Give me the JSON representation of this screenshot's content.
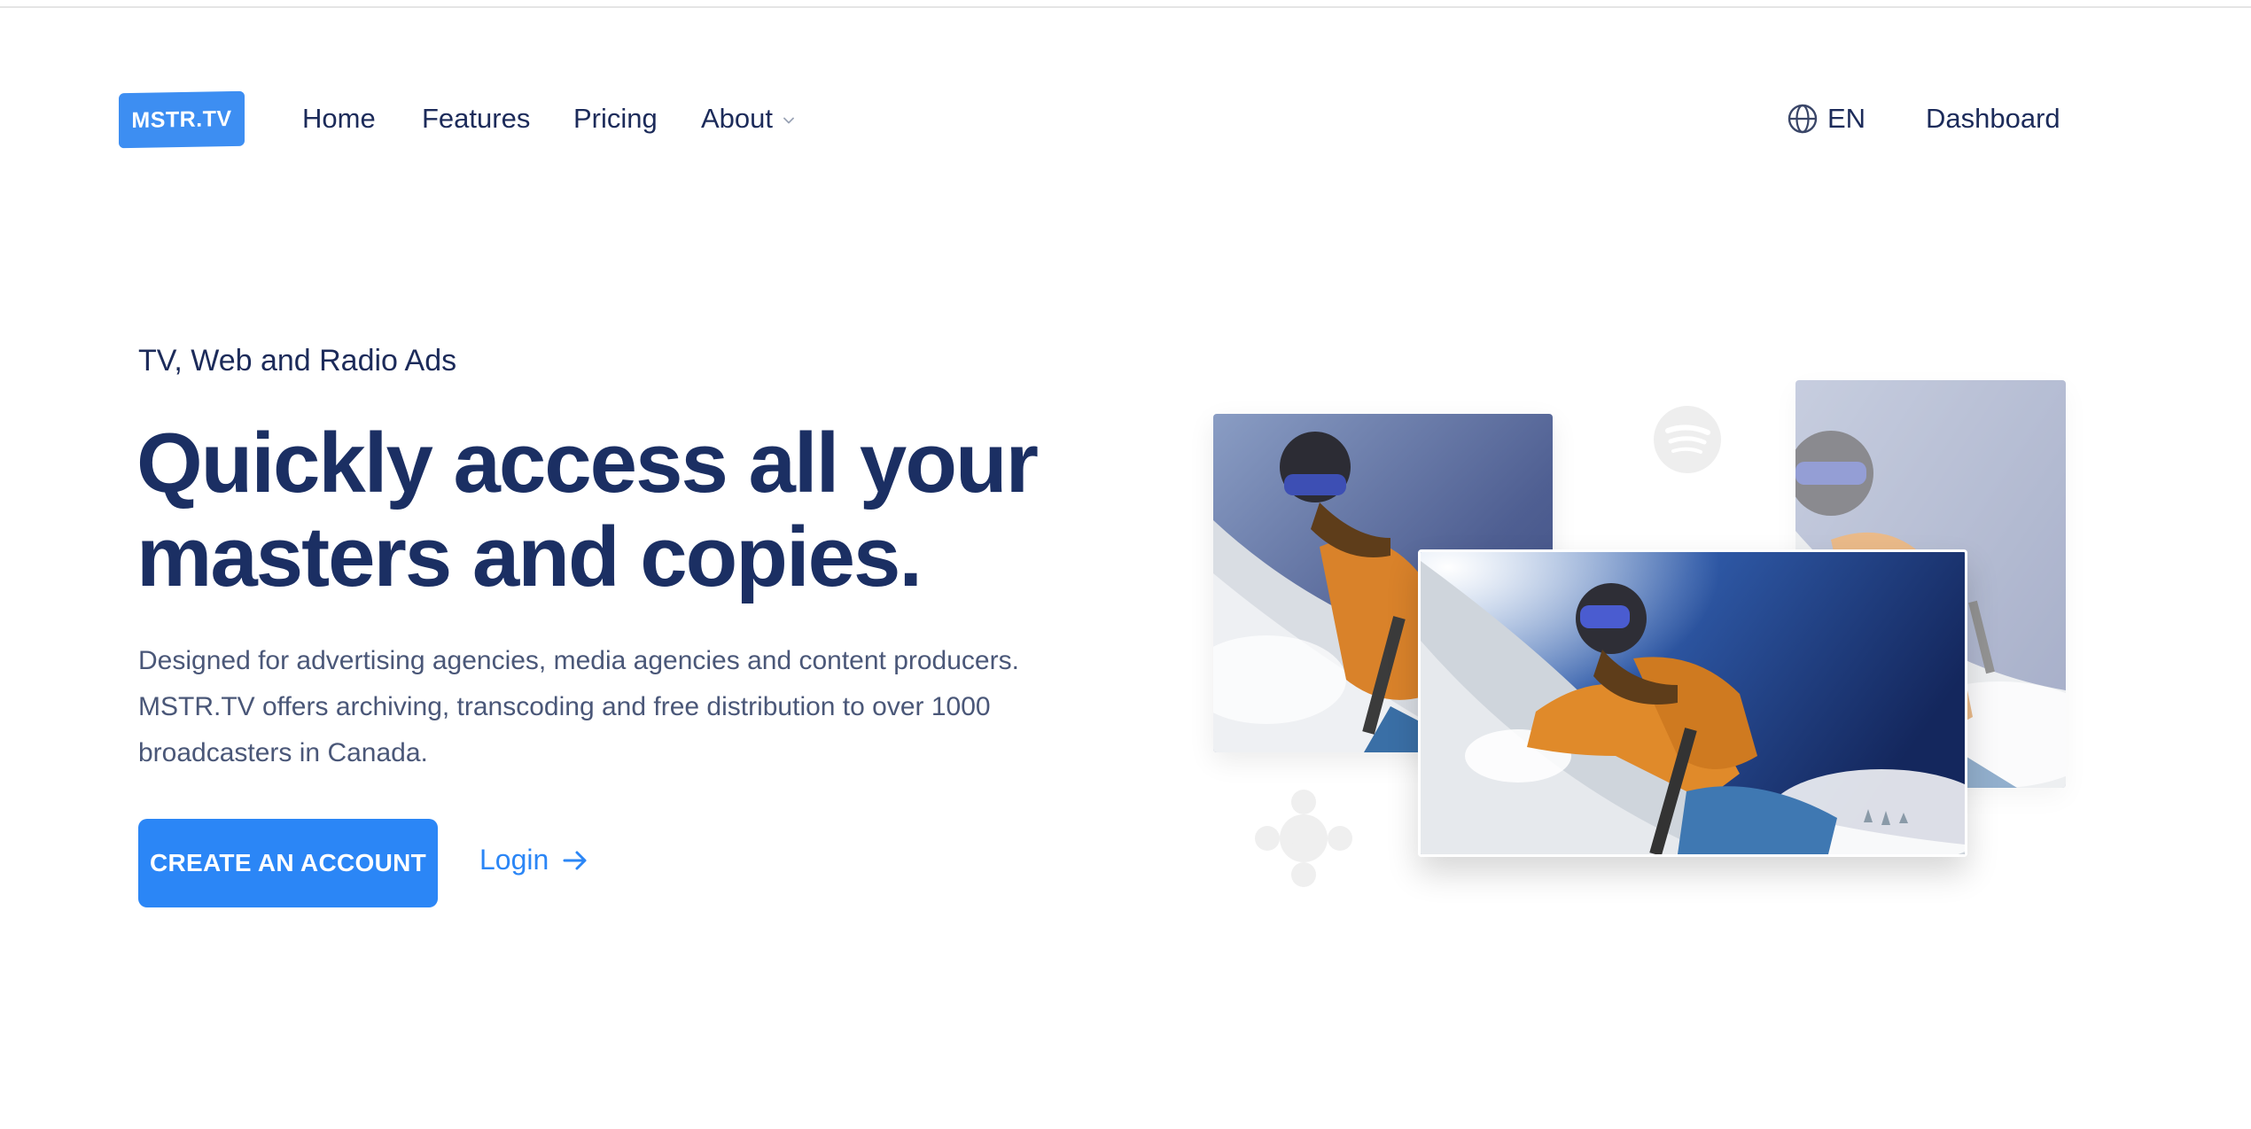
{
  "nav": {
    "logo_text": "MSTR.TV",
    "links": {
      "home": "Home",
      "features": "Features",
      "pricing": "Pricing",
      "about": "About"
    },
    "language": "EN",
    "dashboard": "Dashboard"
  },
  "hero": {
    "eyebrow": "TV, Web and Radio Ads",
    "headline_line1": "Quickly access all your",
    "headline_line2": "masters and copies.",
    "description_line1": "Designed for advertising agencies, media agencies and content producers.",
    "description_line2": "MSTR.TV offers archiving, transcoding and free distribution to over 1000",
    "description_line3": "broadcasters in Canada.",
    "cta_label": "CREATE AN ACCOUNT",
    "login_label": "Login"
  },
  "icons": {
    "globe": "globe-icon",
    "about_chevron": "chevron-down-icon",
    "login_arrow": "arrow-right-icon",
    "spotify": "spotify-logo",
    "cbc": "cbc-logo"
  },
  "colors": {
    "brand_blue": "#2b86f6",
    "logo_blue": "#3d8ef2",
    "navy_text": "#1b2f63",
    "body_text": "#4a5778"
  }
}
